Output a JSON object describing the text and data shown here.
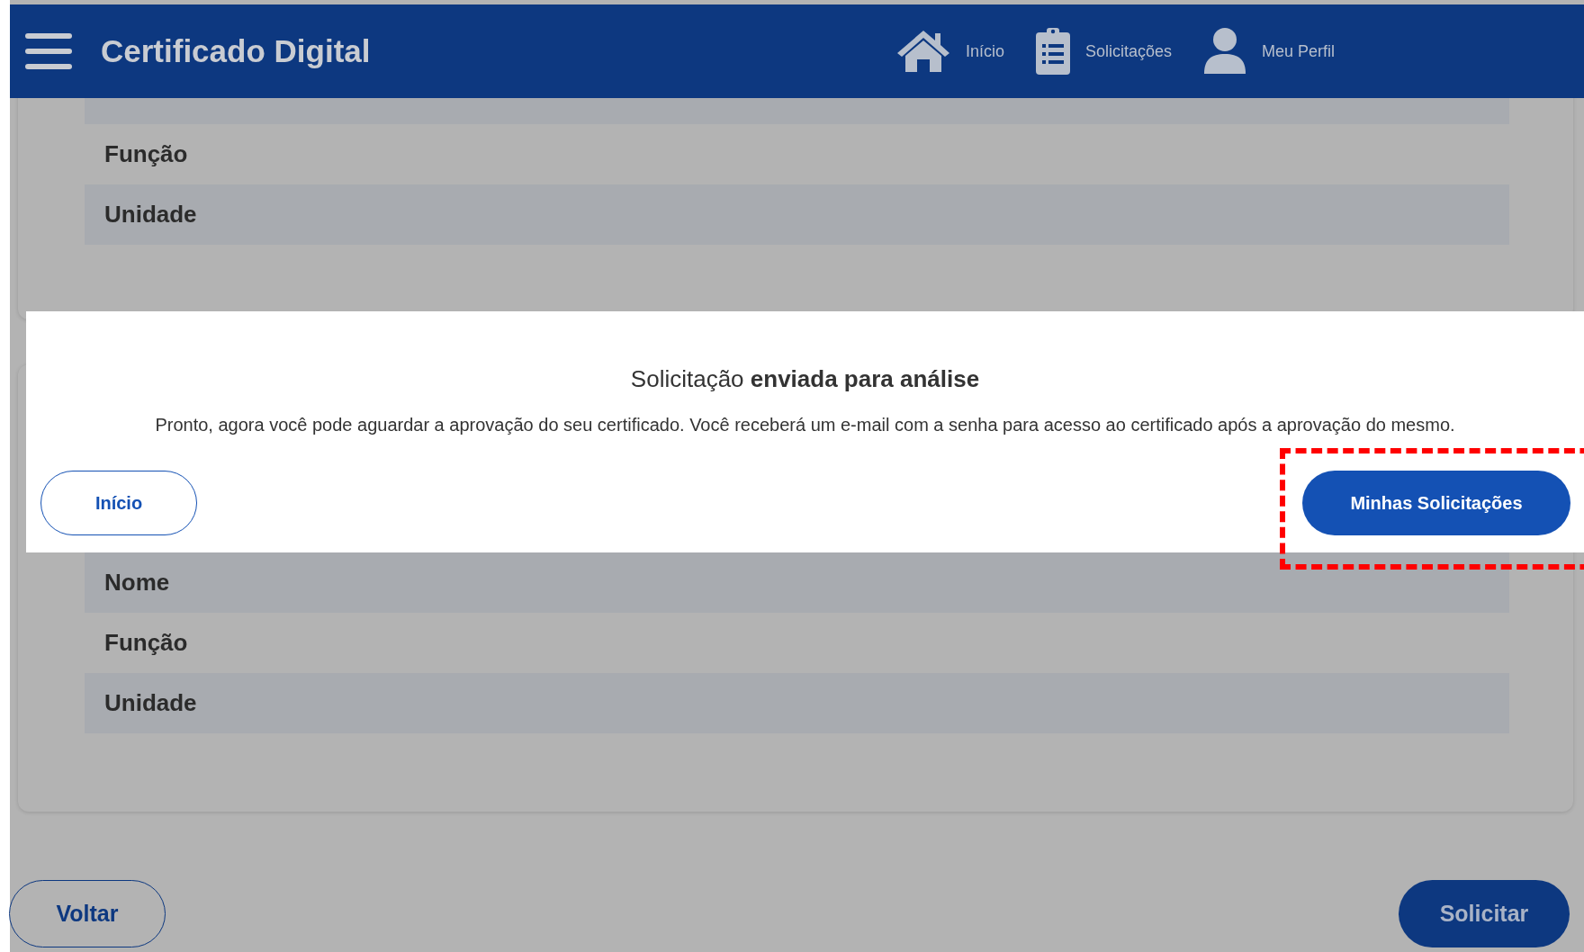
{
  "header": {
    "title": "Certificado Digital",
    "nav": [
      {
        "label": "Início",
        "kind": "home"
      },
      {
        "label": "Solicitações",
        "kind": "clipboard"
      },
      {
        "label": "Meu Perfil",
        "kind": "person"
      }
    ]
  },
  "cards": [
    {
      "cut_top": true,
      "rows": [
        "Função",
        "Unidade"
      ]
    },
    {
      "rows": [
        "Nome",
        "Função",
        "Unidade"
      ]
    }
  ],
  "modal": {
    "title": "Solicitação **enviada para análise**",
    "message": "Pronto, agora você pode aguardar a aprovação do seu certificado. Você receberá um e-mail com a senha para acesso ao certificado após a aprovação do mesmo.",
    "buttons": [
      {
        "label": "Início",
        "kind": "outline",
        "highlighted": false
      },
      {
        "label": "Minhas Solicitações",
        "kind": "primary",
        "highlighted": true
      }
    ]
  },
  "footer_buttons": [
    {
      "label": "Voltar",
      "kind": "outline"
    },
    {
      "label": "Solicitar",
      "kind": "primary"
    }
  ]
}
